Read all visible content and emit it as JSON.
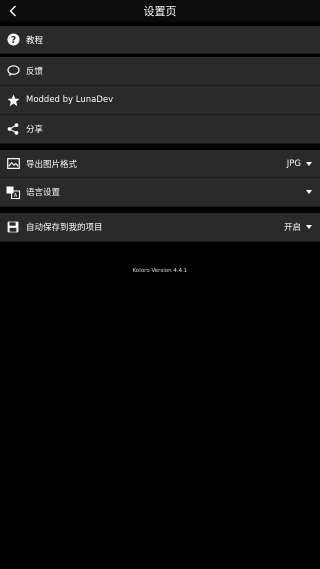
{
  "header": {
    "title": "设置页"
  },
  "group1": {
    "items": [
      {
        "label": "教程",
        "icon": "question-circle-icon"
      },
      {
        "label": "反馈",
        "icon": "speech-bubble-icon"
      },
      {
        "label": "Modded by LunaDev",
        "icon": "star-icon"
      },
      {
        "label": "分享",
        "icon": "share-icon"
      }
    ]
  },
  "group2": {
    "items": [
      {
        "label": "导出图片格式",
        "value": "JPG",
        "icon": "image-icon"
      },
      {
        "label": "语言设置",
        "value": "",
        "icon": "language-icon"
      }
    ]
  },
  "group3": {
    "items": [
      {
        "label": "自动保存到我的项目",
        "value": "开启",
        "icon": "save-icon"
      }
    ]
  },
  "footer": {
    "version": "Koloro Version 4.4.1"
  }
}
